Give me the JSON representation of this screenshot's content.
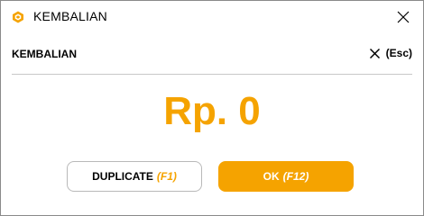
{
  "window": {
    "title": "KEMBALIAN",
    "icon": "app-logo-icon",
    "close_icon": "close-icon"
  },
  "header": {
    "title": "KEMBALIAN",
    "close_shortcut": "(Esc)",
    "close_icon": "close-icon"
  },
  "amount": {
    "text": "Rp. 0"
  },
  "buttons": {
    "duplicate": {
      "label": "DUPLICATE",
      "shortcut": "(F1)"
    },
    "ok": {
      "label": "OK",
      "shortcut": "(F12)"
    }
  },
  "colors": {
    "accent": "#f5a300",
    "text": "#000000",
    "divider": "#c8c8c8",
    "button_border": "#b9b9b9"
  }
}
